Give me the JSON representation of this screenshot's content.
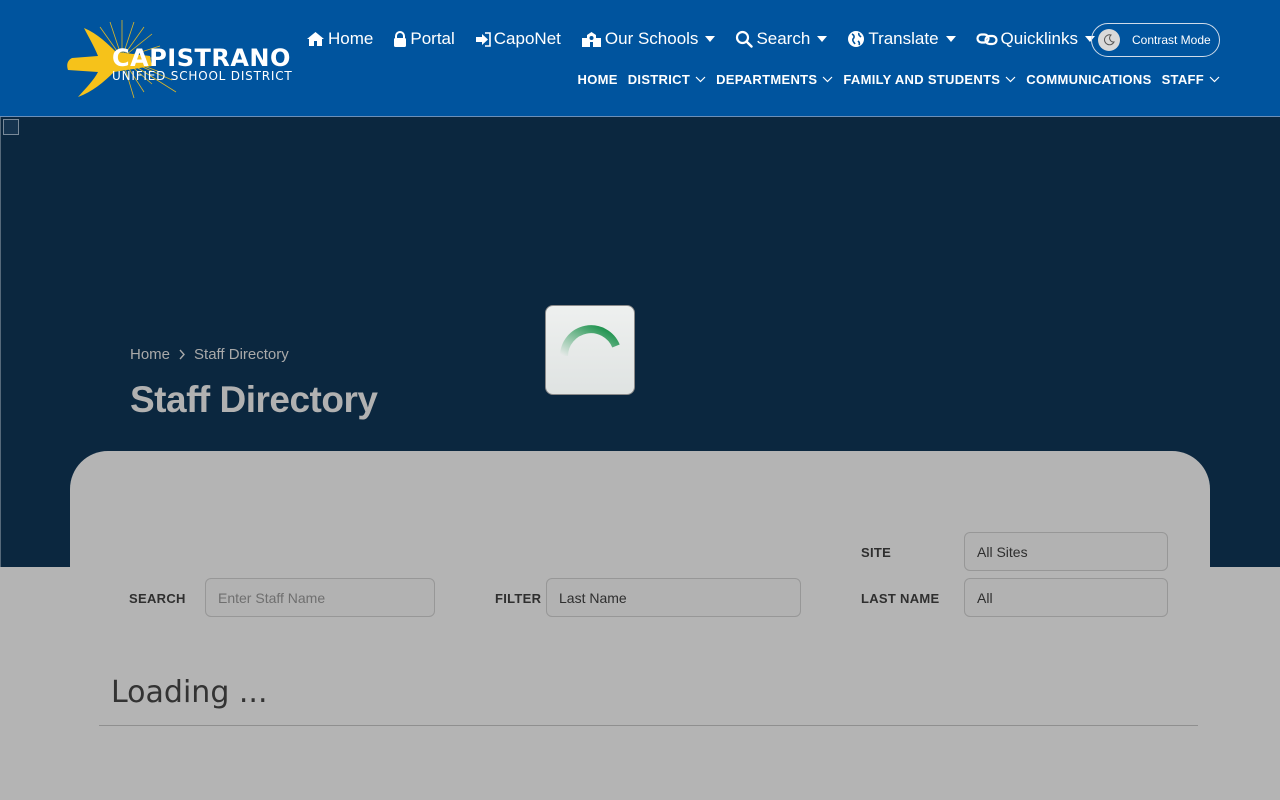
{
  "logo": {
    "line1": "CAPISTRANO",
    "line2": "UNIFIED SCHOOL DISTRICT"
  },
  "topnav": [
    {
      "label": "Home",
      "icon": "home-icon"
    },
    {
      "label": "Portal",
      "icon": "lock-icon"
    },
    {
      "label": "CapoNet",
      "icon": "sign-in-icon"
    },
    {
      "label": "Our Schools",
      "icon": "school-icon",
      "dropdown": true
    },
    {
      "label": "Search",
      "icon": "search-icon",
      "dropdown": true
    },
    {
      "label": "Translate",
      "icon": "globe-icon",
      "dropdown": true
    },
    {
      "label": "Quicklinks",
      "icon": "link-icon",
      "dropdown": true
    }
  ],
  "contrast_mode": {
    "label": "Contrast Mode",
    "icon": "moon-icon"
  },
  "subnav": [
    {
      "label": "HOME"
    },
    {
      "label": "DISTRICT",
      "dropdown": true
    },
    {
      "label": "DEPARTMENTS",
      "dropdown": true
    },
    {
      "label": "FAMILY AND STUDENTS",
      "dropdown": true
    },
    {
      "label": "COMMUNICATIONS"
    },
    {
      "label": "STAFF",
      "dropdown": true
    }
  ],
  "breadcrumb": {
    "home": "Home",
    "current": "Staff Directory"
  },
  "page_title": "Staff Directory",
  "filters": {
    "search": {
      "label": "SEARCH",
      "placeholder": "Enter Staff Name"
    },
    "filter": {
      "label": "FILTER",
      "value": "Last Name"
    },
    "site": {
      "label": "SITE",
      "value": "All Sites"
    },
    "last_name": {
      "label": "LAST NAME",
      "value": "All"
    }
  },
  "status": {
    "loading": "Loading ..."
  },
  "colors": {
    "header_bg": "#00549e",
    "hero_bg": "#0b273f",
    "logo_yellow": "#f6c21a",
    "spinner_green": "#0a8a3e"
  }
}
